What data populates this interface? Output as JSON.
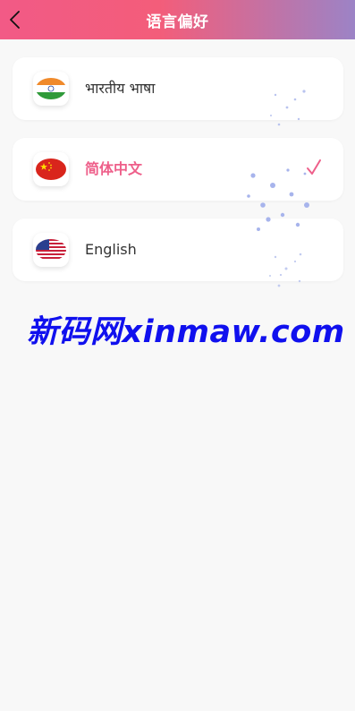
{
  "header": {
    "title": "语言偏好",
    "gradient_start": "#f25a86",
    "gradient_end": "#9c83c6"
  },
  "languages": [
    {
      "label": "भारतीय भाषा",
      "flag": "india-flag-icon",
      "selected": false
    },
    {
      "label": "简体中文",
      "flag": "china-flag-icon",
      "selected": true
    },
    {
      "label": "English",
      "flag": "usa-flag-icon",
      "selected": false
    }
  ],
  "selected_color": "#ee5f8a",
  "watermark": {
    "text": "新码网xinmaw.com",
    "color": "#1010ee"
  }
}
